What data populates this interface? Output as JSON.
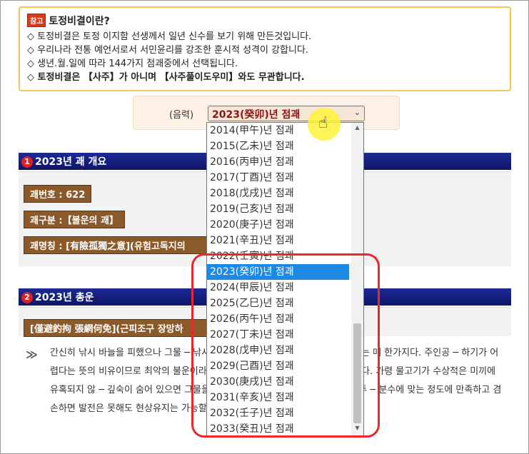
{
  "notice": {
    "badge": "참고",
    "title": "토정비결이란?",
    "lines": [
      "◇ 토정비결은 토정 이지함 선생께서 일년 신수를 보기 위해 만든것입니다.",
      "◇ 우리나라 전통 예언서로서 서민윤리를 강조한 훈시적 성격이 강합니다.",
      "◇ 생년.월.일에 따라 144가지 점괘중에서 선택됩니다.",
      "◇ 토정비결은 【사주】가 아니며 【사주풀이도우미】와도 무관합니다."
    ]
  },
  "selector": {
    "label": "(음력)",
    "selected": "2023(癸卯)년 점괘",
    "arrow": "⌄",
    "options": [
      "2014(甲午)년 점괘",
      "2015(乙未)년 점괘",
      "2016(丙申)년 점괘",
      "2017(丁酉)년 점괘",
      "2018(戊戌)년 점괘",
      "2019(己亥)년 점괘",
      "2020(庚子)년 점괘",
      "2021(辛丑)년 점괘",
      "2022(壬寅)년 점괘",
      "2023(癸卯)년 점괘",
      "2024(甲辰)년 점괘",
      "2025(乙巳)년 점괘",
      "2026(丙午)년 점괘",
      "2027(丁未)년 점괘",
      "2028(戊申)년 점괘",
      "2029(己酉)년 점괘",
      "2030(庚戌)년 점괘",
      "2031(辛亥)년 점괘",
      "2032(壬子)년 점괘",
      "2033(癸丑)년 점괘"
    ],
    "selected_index": 9
  },
  "section1": {
    "num": "1",
    "title": "2023년 괘 개요",
    "tags": [
      "괘번호 : 622",
      "괘구분 :【불운의 괘】",
      "괘명칭 : [有險孤獨之意](유험고독지의"
    ]
  },
  "section2": {
    "num": "2",
    "title": "2023년 총운",
    "tag": "[僅避釣拘 張網何免](근피조구 장망하",
    "marker": "≫",
    "paragraph": "간신히 낚시 바늘을 피했으나 그물 ─ 낚시에 걸리거나 그물에 걸리거나 잡혀 죽기는 매 한가지다. 주인공 ─ 하기가 어렵다는 뜻의 비유이므로 최악의 불운이라 하겠다. 그러나 ─ 으로 생각해서는 안된다. 가령 물고기가 수상적은 미끼에 유혹되지 않 ─ 깊숙이 숨어 있으면 그물을 피할 수 있듯이 주인공은 재물을 탐해 투 ─ 분수에 맞는 정도에 만족하고 겸손하면 발전은 못해도 현상유지는 가능할 것이다 이점 늦지 말아야 하겠다."
  },
  "colors": {
    "accent": "#e8282d",
    "header": "#1c2a94",
    "tag": "#8b5a2b",
    "selected": "#1e88e5"
  }
}
